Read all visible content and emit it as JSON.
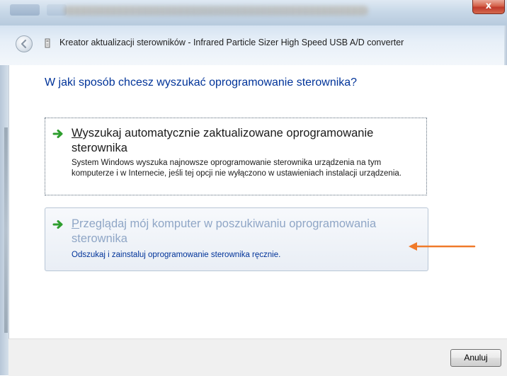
{
  "window": {
    "title_close_label": "x",
    "wizard_title": "Kreator aktualizacji sterowników - Infrared Particle Sizer High Speed USB A/D converter"
  },
  "main": {
    "question": "W jaki sposób chcesz wyszukać oprogramowanie sterownika?",
    "options": [
      {
        "accel": "W",
        "title_rest": "yszukaj automatycznie zaktualizowane oprogramowanie sterownika",
        "description": "System Windows wyszuka najnowsze oprogramowanie sterownika urządzenia na tym komputerze i w Internecie, jeśli tej opcji nie wyłączono w ustawieniach instalacji urządzenia."
      },
      {
        "accel": "P",
        "title_rest": "rzeglądaj mój komputer w poszukiwaniu oprogramowania sterownika",
        "description": "Odszukaj i zainstaluj oprogramowanie sterownika ręcznie."
      }
    ]
  },
  "footer": {
    "cancel_label": "Anuluj"
  },
  "colors": {
    "heading_blue": "#003399",
    "hover_title": "#8fa6c6",
    "arrow_green": "#2e9e2e",
    "annotation_orange": "#f07a2a"
  },
  "icons": {
    "back": "back-arrow-icon",
    "wizard": "driver-wizard-icon",
    "option_arrow": "green-arrow-icon",
    "annotation": "orange-arrow-icon"
  }
}
